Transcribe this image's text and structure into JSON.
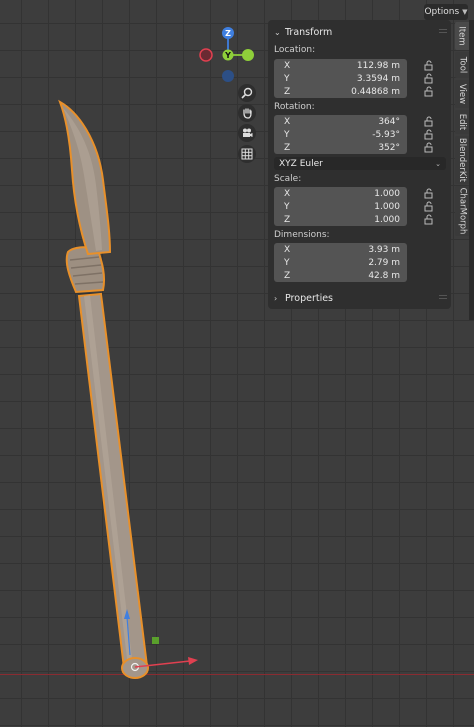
{
  "header": {
    "options_label": "Options"
  },
  "gizmo": {
    "z_label": "Z",
    "y_label": "Y",
    "colors": {
      "x": "#e04050",
      "y": "#8fcf3a",
      "z": "#3f7fe0"
    }
  },
  "nav_tools": [
    "zoom-icon",
    "hand-pan-icon",
    "camera-icon",
    "grid-icon"
  ],
  "transform": {
    "title": "Transform",
    "location_label": "Location:",
    "location": [
      {
        "axis": "X",
        "value": "112.98 m"
      },
      {
        "axis": "Y",
        "value": "3.3594 m"
      },
      {
        "axis": "Z",
        "value": "0.44868 m"
      }
    ],
    "rotation_label": "Rotation:",
    "rotation": [
      {
        "axis": "X",
        "value": "364°"
      },
      {
        "axis": "Y",
        "value": "-5.93°"
      },
      {
        "axis": "Z",
        "value": "352°"
      }
    ],
    "rotation_mode": "XYZ Euler",
    "scale_label": "Scale:",
    "scale": [
      {
        "axis": "X",
        "value": "1.000"
      },
      {
        "axis": "Y",
        "value": "1.000"
      },
      {
        "axis": "Z",
        "value": "1.000"
      }
    ],
    "dimensions_label": "Dimensions:",
    "dimensions": [
      {
        "axis": "X",
        "value": "3.93 m"
      },
      {
        "axis": "Y",
        "value": "2.79 m"
      },
      {
        "axis": "Z",
        "value": "42.8 m"
      }
    ]
  },
  "properties": {
    "title": "Properties"
  },
  "sidebar_tabs": [
    "Item",
    "Tool",
    "View",
    "Edit",
    "BlenderKit",
    "CharMorph"
  ],
  "colors": {
    "selection_outline": "#e8902a",
    "mesh": "#a89a8a",
    "x_axis": "#e04050"
  }
}
